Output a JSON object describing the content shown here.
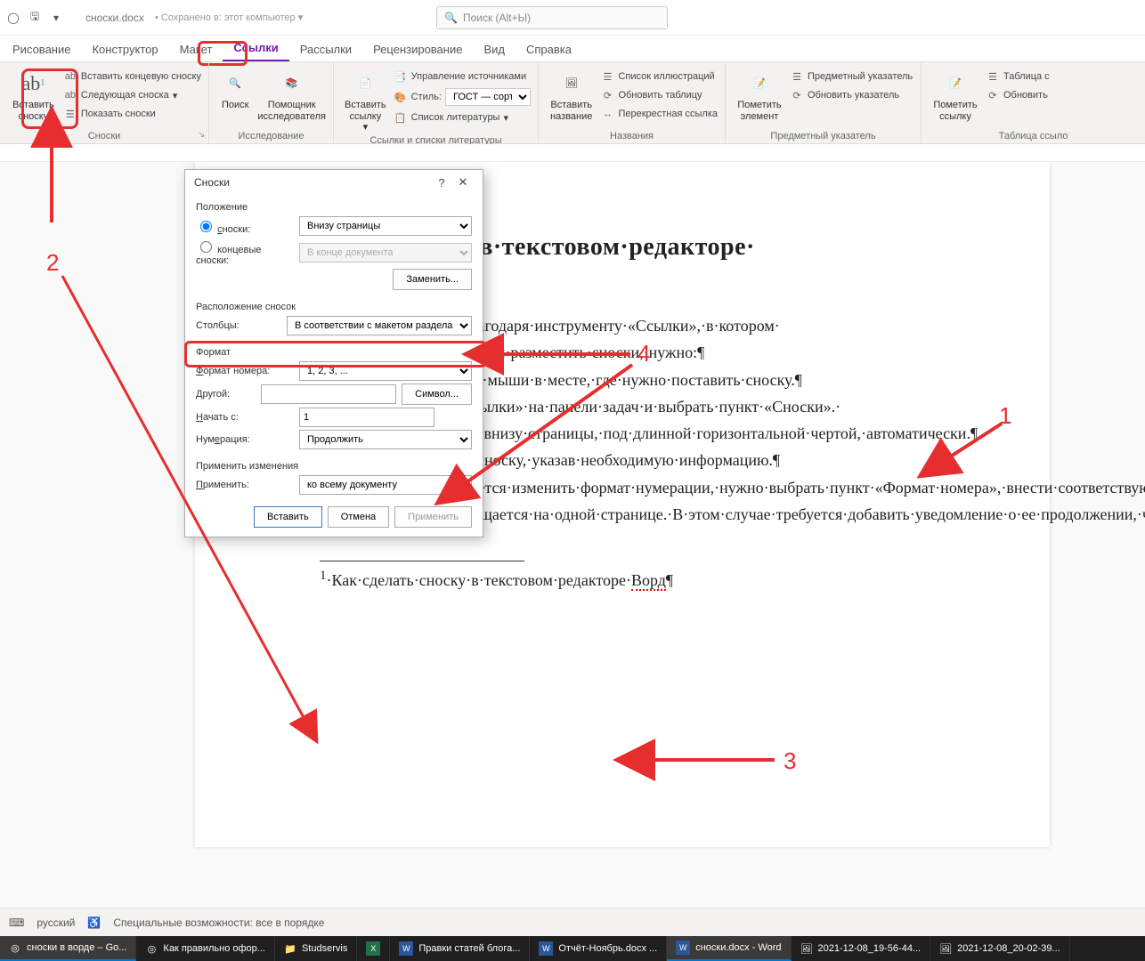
{
  "titlebar": {
    "filename": "сноски.docx",
    "saved_label": "Сохранено в: этот компьютер",
    "search_placeholder": "Поиск (Alt+Ы)"
  },
  "tabs": [
    "Рисование",
    "Конструктор",
    "Макет",
    "Ссылки",
    "Рассылки",
    "Рецензирование",
    "Вид",
    "Справка"
  ],
  "active_tab_index": 3,
  "ribbon": {
    "footnotes": {
      "insert_footnote": "Вставить сноску",
      "insert_endnote": "Вставить концевую сноску",
      "next_footnote": "Следующая сноска",
      "show_notes": "Показать сноски",
      "group": "Сноски"
    },
    "research": {
      "search": "Поиск",
      "researcher": "Помощник исследователя",
      "group": "Исследование"
    },
    "citations": {
      "insert_citation": "Вставить ссылку",
      "manage_sources": "Управление источниками",
      "style_label": "Стиль:",
      "style_value": "ГОСТ — сортиро…",
      "bibliography": "Список литературы",
      "group": "Ссылки и списки литературы"
    },
    "captions": {
      "insert_caption": "Вставить название",
      "list_of_figures": "Список иллюстраций",
      "update_table": "Обновить таблицу",
      "cross_reference": "Перекрестная ссылка",
      "group": "Названия"
    },
    "index": {
      "mark_entry": "Пометить элемент",
      "insert_index": "Предметный указатель",
      "update_index": "Обновить указатель",
      "group": "Предметный указатель"
    },
    "toa": {
      "mark_citation": "Пометить ссылку",
      "insert_toa": "Таблица с",
      "update_toa": "Обновить",
      "group": "Таблица ссыло"
    }
  },
  "dialog": {
    "title": "Сноски",
    "position_head": "Положение",
    "footnotes_label": "сноски:",
    "footnotes_value": "Внизу страницы",
    "endnotes_label": "концевые сноски:",
    "endnotes_value": "В конце документа",
    "convert": "Заменить...",
    "layout_head": "Расположение сносок",
    "columns_label": "Столбцы:",
    "columns_value": "В соответствии с макетом раздела",
    "format_head": "Формат",
    "number_format_label": "Формат номера:",
    "number_format_value": "1, 2, 3, ...",
    "custom_label": "Другой:",
    "symbol_btn": "Символ...",
    "start_at_label": "Начать с:",
    "start_at_value": "1",
    "numbering_label": "Нумерация:",
    "numbering_value": "Продолжить",
    "apply_head": "Применить изменения",
    "apply_to_label": "Применить:",
    "apply_to_value": "ко всему документу",
    "insert_btn": "Вставить",
    "cancel_btn": "Отмена",
    "apply_btn": "Применить"
  },
  "document": {
    "heading": "…ать·сноску·в·текстовом·редакторе·",
    "para1": "…·довольно·просто·благодаря·инструменту·«Ссылки»,·в·котором·",
    "para1b": "…носки».·Для·того,·чтобы·разместить·сноски,·нужно:¶",
    "li1": "…евой·кнопкой·мыши·в·месте,·где·нужно·поставить·сноску.¶",
    "li2a": "…·вкладку·«Ссылки»·на·панели·задач·и·выбрать·пункт·«Сноски».·",
    "li2b": "…·установлена·внизу·страницы,·под·длинной·горизонтальной·чертой,·автоматически.¶",
    "li3": "3.→Заполнить·сноску,·указав·необходимую·информацию.¶",
    "li4": "4.→Если·требуется·изменить·формат·нумерации,·нужно·выбрать·пункт·«Формат·номера»,·внести·соответствующие·изменения·и·нажать·кнопку·«Применить».¶",
    "para2": "Иногда·сноска·не·помещается·на·одной·странице.·В·этом·случае·требуется·добавить·уведомление·о·ее·продолжении,·чтобы·проверяющий·и·читающий·диплом·понимал,·что·сноска·не·закончена.·Чтобы·сделать·это,·нужно:¶",
    "footnote_text_prefix": "·Как·сделать·сноску·в·текстовом·редакторе·",
    "footnote_text_word": "Ворд",
    "footnote_text_suffix": "¶"
  },
  "annotations": {
    "n1": "1",
    "n2": "2",
    "n3": "3",
    "n4": "4"
  },
  "status": {
    "lang": "русский",
    "accessibility": "Специальные возможности: все в порядке"
  },
  "taskbar": [
    {
      "label": "сноски в ворде – Go...",
      "icon": "chrome",
      "active": true
    },
    {
      "label": "Как правильно офор...",
      "icon": "chrome"
    },
    {
      "label": "Studservis",
      "icon": "folder"
    },
    {
      "label": "",
      "icon": "excel"
    },
    {
      "label": "Правки статей блога...",
      "icon": "word"
    },
    {
      "label": "Отчёт-Ноябрь.docx ...",
      "icon": "word"
    },
    {
      "label": "сноски.docx - Word",
      "icon": "word",
      "active": true
    },
    {
      "label": "2021-12-08_19-56-44...",
      "icon": "image"
    },
    {
      "label": "2021-12-08_20-02-39...",
      "icon": "image"
    }
  ]
}
